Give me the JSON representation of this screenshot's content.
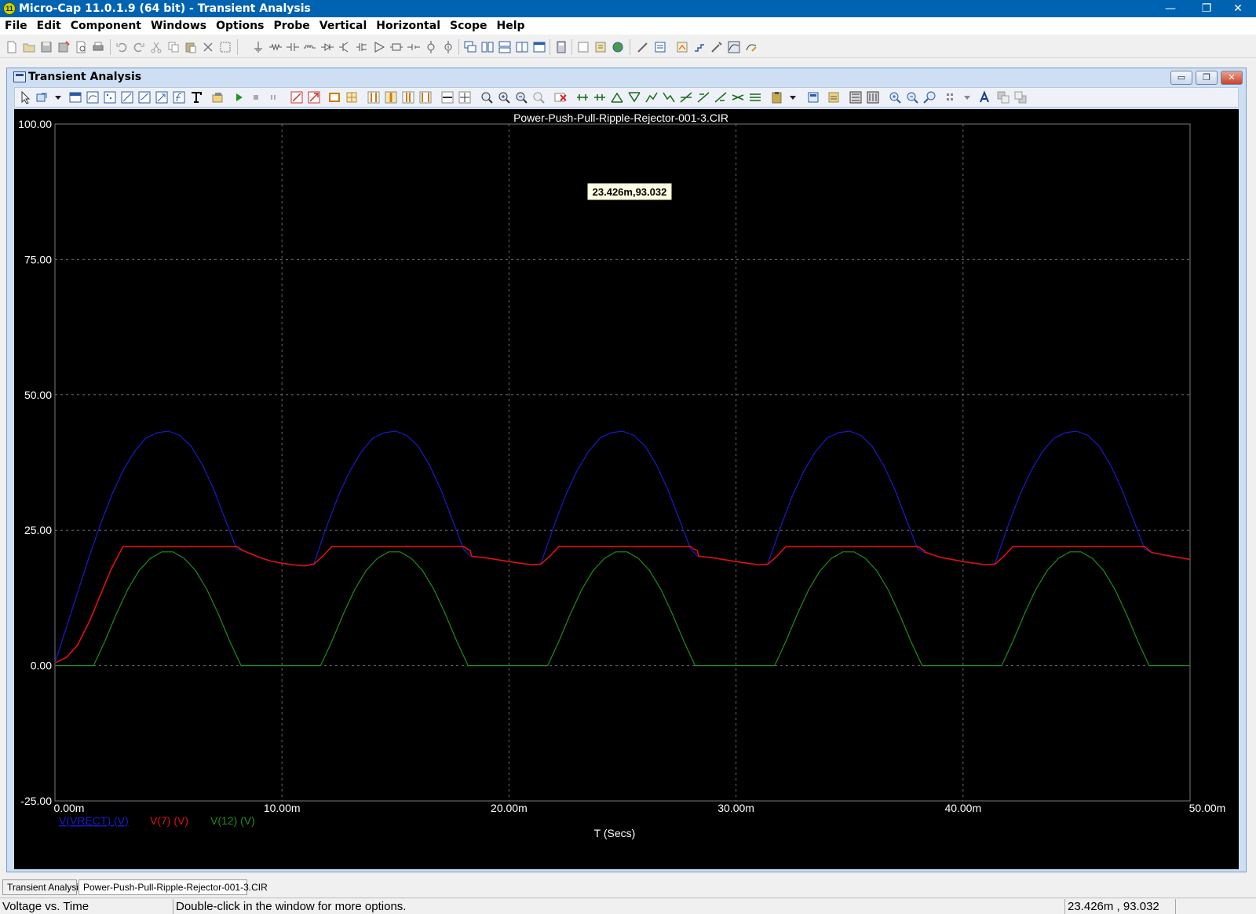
{
  "window": {
    "title": "Micro-Cap 11.0.1.9 (64 bit) - Transient Analysis",
    "icon_text": "11",
    "minimize_glyph": "—",
    "maximize_glyph": "❐",
    "close_glyph": "✕"
  },
  "menu": [
    "File",
    "Edit",
    "Component",
    "Windows",
    "Options",
    "Probe",
    "Vertical",
    "Horizontal",
    "Scope",
    "Help"
  ],
  "child_window": {
    "title": "Transient Analysis",
    "min_glyph": "▭",
    "restore_glyph": "❐",
    "close_glyph": "✕"
  },
  "chart_data": {
    "type": "line",
    "title": "Power-Push-Pull-Ripple-Rejector-001-3.CIR",
    "xlabel": "T (Secs)",
    "ylabel": "",
    "xlim": [
      0,
      50
    ],
    "ylim": [
      -25,
      100
    ],
    "x_unit": "ms",
    "x_ticks": [
      0,
      10,
      20,
      30,
      40,
      50
    ],
    "x_tick_labels": [
      "0.00m",
      "10.00m",
      "20.00m",
      "30.00m",
      "40.00m",
      "50.00m"
    ],
    "y_ticks": [
      -25,
      0,
      25,
      50,
      75,
      100
    ],
    "y_tick_labels": [
      "-25.00",
      "0.00",
      "25.00",
      "50.00",
      "75.00",
      "100.00"
    ],
    "grid": true,
    "background": "#000000",
    "grid_color": "#6a6a6a",
    "cursor_readout": "23.426m,93.032",
    "series": [
      {
        "name": "V(VRECT) (V)",
        "color": "#1a1acc",
        "x": [
          0,
          0.5,
          1,
          1.5,
          2,
          2.5,
          3,
          3.5,
          4,
          4.5,
          5,
          5.5,
          6,
          6.5,
          7,
          7.5,
          8,
          8.3,
          9,
          9.5,
          10,
          10.5,
          11,
          11.4,
          12,
          12.5,
          13,
          13.5,
          14,
          14.5,
          15,
          15.5,
          16,
          16.5,
          17,
          17.5,
          18,
          18.3,
          19,
          20,
          21,
          21.4,
          22,
          22.5,
          23,
          23.5,
          24,
          24.5,
          25,
          25.5,
          26,
          26.5,
          27,
          27.5,
          28,
          28.3,
          29,
          30,
          31,
          31.4,
          32,
          32.5,
          33,
          33.5,
          34,
          34.5,
          35,
          35.5,
          36,
          36.5,
          37,
          37.5,
          38,
          38.3,
          39,
          40,
          41,
          41.4,
          42,
          42.5,
          43,
          43.5,
          44,
          44.5,
          45,
          45.5,
          46,
          46.5,
          47,
          47.5,
          48,
          48.3,
          49,
          50
        ],
        "y": [
          0.5,
          7,
          13.5,
          20,
          26,
          31.5,
          36,
          39.5,
          42,
          43,
          43.3,
          42.5,
          40.5,
          37,
          32.5,
          27,
          21.5,
          21.2,
          20,
          19.3,
          18.9,
          18.6,
          18.4,
          18.8,
          26,
          31.5,
          36,
          39.5,
          42,
          43,
          43.3,
          42.5,
          40.5,
          37,
          32.5,
          27,
          21.5,
          20.2,
          19.9,
          19.2,
          18.6,
          18.8,
          26,
          31.5,
          36,
          39.5,
          42,
          43,
          43.3,
          42.5,
          40.5,
          37,
          32.5,
          27,
          21.5,
          20.2,
          19.9,
          19.2,
          18.6,
          18.8,
          26,
          31.5,
          36,
          39.5,
          42,
          43,
          43.3,
          42.5,
          40.5,
          37,
          32.5,
          27,
          21.5,
          20.9,
          20,
          19.2,
          18.6,
          18.8,
          26,
          31.5,
          36,
          39.5,
          42,
          43,
          43.3,
          42.5,
          40.5,
          37,
          32.5,
          27,
          21.5,
          20.9,
          20.3,
          19.6
        ]
      },
      {
        "name": "V(7) (V)",
        "color": "#e01010",
        "x": [
          0,
          0.5,
          1,
          1.5,
          2,
          2.5,
          3,
          4,
          5,
          6,
          7,
          8,
          8.3,
          9,
          9.5,
          10,
          10.5,
          11,
          11.4,
          11.8,
          12.2,
          12.7,
          13,
          15,
          17,
          18,
          18.3,
          18.35,
          19,
          20,
          21,
          21.4,
          21.8,
          22.2,
          22.7,
          23,
          25,
          27,
          28,
          28.1,
          28.3,
          28.35,
          29,
          30,
          31,
          31.4,
          31.8,
          32.2,
          32.7,
          33,
          35,
          37,
          38,
          38.3,
          38.35,
          39,
          40,
          41,
          41.4,
          41.8,
          42.2,
          42.7,
          43,
          45,
          47,
          48,
          48.3,
          49,
          50
        ],
        "y": [
          0.5,
          1.5,
          3.8,
          8,
          13,
          18,
          22,
          22,
          22,
          22,
          22,
          22,
          21.2,
          20,
          19.3,
          18.9,
          18.6,
          18.4,
          18.7,
          20.2,
          22,
          22,
          22,
          22,
          22,
          22,
          21.2,
          20.2,
          19.9,
          19.2,
          18.6,
          18.7,
          20.2,
          22,
          22,
          22,
          22,
          22,
          22,
          21.6,
          21.2,
          20.2,
          19.9,
          19.2,
          18.6,
          18.7,
          20.2,
          22,
          22,
          22,
          22,
          22,
          22,
          21.2,
          20.9,
          20,
          19.2,
          18.6,
          18.7,
          20.2,
          22,
          22,
          22,
          22,
          22,
          22,
          20.9,
          20.3,
          19.6
        ]
      },
      {
        "name": "V(12) (V)",
        "color": "#1f8c1f",
        "x": [
          0,
          1.7,
          2.2,
          2.7,
          3.2,
          3.7,
          4.2,
          4.7,
          5.2,
          5.7,
          6.2,
          6.7,
          7.2,
          7.7,
          8.2,
          11.7,
          12.2,
          12.7,
          13.2,
          13.7,
          14.2,
          14.7,
          15.2,
          15.7,
          16.2,
          16.7,
          17.2,
          17.7,
          18.2,
          21.7,
          22.2,
          22.7,
          23.2,
          23.7,
          24.2,
          24.7,
          25.2,
          25.7,
          26.2,
          26.7,
          27.2,
          27.7,
          28.2,
          31.7,
          32.2,
          32.7,
          33.2,
          33.7,
          34.2,
          34.7,
          35.2,
          35.7,
          36.2,
          36.7,
          37.2,
          37.7,
          38.2,
          41.7,
          42.2,
          42.7,
          43.2,
          43.7,
          44.2,
          44.7,
          45.2,
          45.7,
          46.2,
          46.7,
          47.2,
          47.7,
          48.2,
          50
        ],
        "y": [
          0,
          0,
          4.5,
          9.5,
          14,
          17.5,
          19.8,
          21,
          21,
          19.8,
          17.5,
          14,
          9.5,
          4.5,
          0,
          0,
          4.5,
          9.5,
          14,
          17.5,
          19.8,
          21,
          21,
          19.8,
          17.5,
          14,
          9.5,
          4.5,
          0,
          0,
          4.5,
          9.5,
          14,
          17.5,
          19.8,
          21,
          21,
          19.8,
          17.5,
          14,
          9.5,
          4.5,
          0,
          0,
          4.5,
          9.5,
          14,
          17.5,
          19.8,
          21,
          21,
          19.8,
          17.5,
          14,
          9.5,
          4.5,
          0,
          0,
          4.5,
          9.5,
          14,
          17.5,
          19.8,
          21,
          21,
          19.8,
          17.5,
          14,
          9.5,
          4.5,
          0,
          0
        ]
      }
    ]
  },
  "tabs": [
    "Transient Analysis",
    "Power-Push-Pull-Ripple-Rejector-001-3.CIR"
  ],
  "status": {
    "mode": "Voltage vs. Time",
    "hint": "Double-click in the window for more options.",
    "coords": "23.426m , 93.032"
  }
}
